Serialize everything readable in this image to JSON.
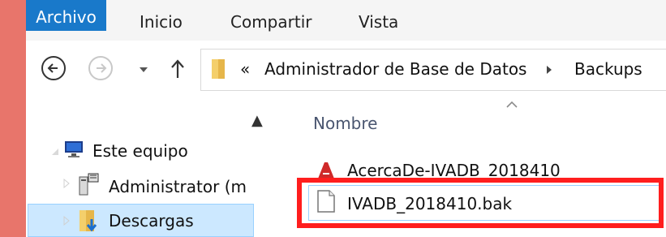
{
  "ribbon": {
    "tabs": [
      "Archivo",
      "Inicio",
      "Compartir",
      "Vista"
    ]
  },
  "address_bar": {
    "overflow": "«",
    "path": [
      "Administrador de Base de Datos",
      "Backups"
    ]
  },
  "nav_pane": {
    "items": [
      {
        "label": "Este equipo",
        "icon": "computer-icon"
      },
      {
        "label": "Administrator (m",
        "icon": "network-drive-icon"
      },
      {
        "label": "Descargas",
        "icon": "downloads-folder-icon"
      }
    ]
  },
  "file_list": {
    "column_header": "Nombre",
    "files": [
      {
        "name": "AcercaDe-IVADB_2018410",
        "icon": "pdf-icon"
      },
      {
        "name": "IVADB_2018410.bak",
        "icon": "file-icon"
      }
    ]
  },
  "colors": {
    "accent": "#1979ca",
    "highlight": "#ff1e1e",
    "selection": "#cce8ff"
  }
}
